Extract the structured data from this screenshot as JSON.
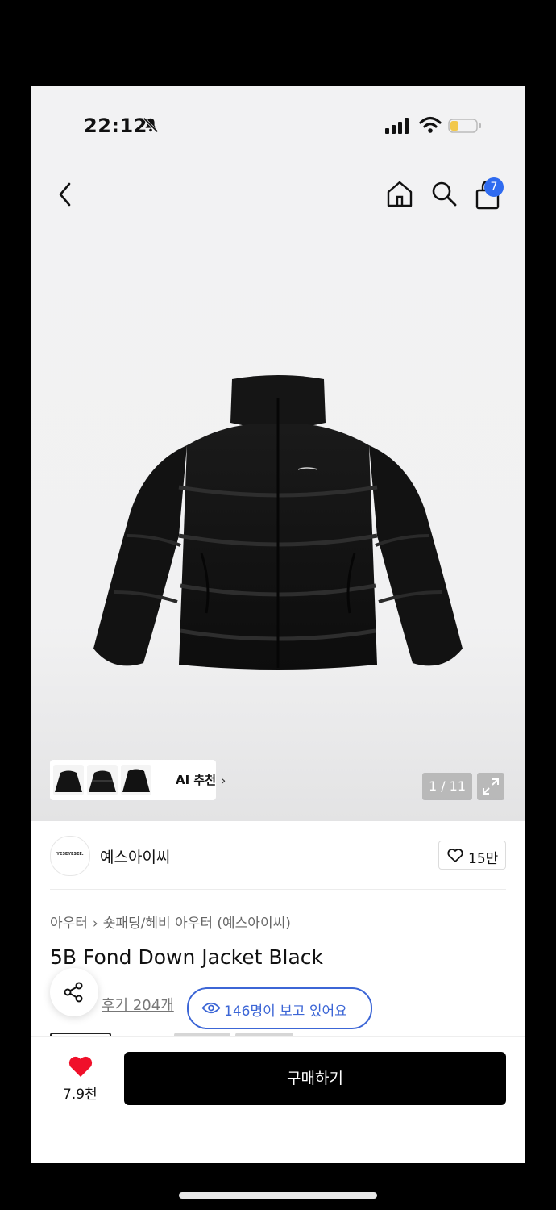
{
  "status_bar": {
    "time": "22:12",
    "icons": [
      "bell-slash-icon",
      "signal-icon",
      "wifi-icon",
      "battery-icon"
    ]
  },
  "header": {
    "icons": [
      "back-chevron-icon",
      "home-icon",
      "search-icon",
      "shopping-bag-icon"
    ],
    "cart_badge": "7",
    "accent_color": "#2f6bf0"
  },
  "gallery": {
    "ai_recommend_label": "AI 추천",
    "counter": "1 / 11",
    "thumbnail_count": 3
  },
  "brand": {
    "logo_text": "YESEYESEE.",
    "name": "예스아이씨",
    "like_count": "15만"
  },
  "breadcrumb": [
    "아우터",
    "숏패딩/헤비 아우터 (예스아이씨)"
  ],
  "product": {
    "title": "5B Fond Down Jacket Black",
    "reviews": "후기 204개",
    "viewers": "146명이 보고 있어요"
  },
  "bottom_bar": {
    "wish_count": "7.9천",
    "buy_label": "구매하기",
    "heart_color": "#f0102a"
  }
}
